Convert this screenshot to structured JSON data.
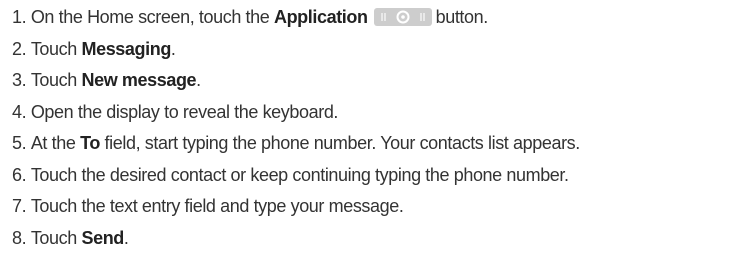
{
  "steps": [
    {
      "num": "1.",
      "pre": "On the Home screen, touch the",
      "bold": "Application",
      "post": "button.",
      "icon": "application-button-icon"
    },
    {
      "num": "2.",
      "pre": "Touch",
      "bold": "Messaging",
      "post": "."
    },
    {
      "num": "3.",
      "pre": "Touch",
      "bold": "New message",
      "post": "."
    },
    {
      "num": "4.",
      "text": "Open the display to reveal the keyboard."
    },
    {
      "num": "5.",
      "pre": "At the",
      "bold": "To",
      "post": "field, start typing the phone number. Your contacts list appears."
    },
    {
      "num": "6.",
      "text": "Touch the desired contact or keep continuing typing the phone number."
    },
    {
      "num": "7.",
      "text": "Touch the text entry field and type your message."
    },
    {
      "num": "8.",
      "pre": "Touch",
      "bold": "Send",
      "post": "."
    }
  ],
  "colors": {
    "text": "#333333",
    "icon_fill": "#c8c8c8"
  }
}
